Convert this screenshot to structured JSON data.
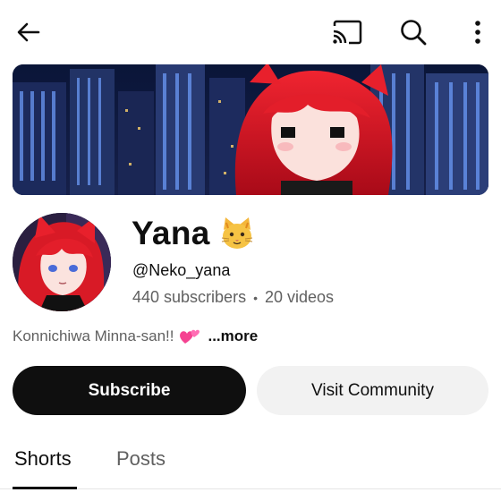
{
  "topbar": {
    "icons": [
      "back-arrow-icon",
      "cast-icon",
      "search-icon",
      "more-vert-icon"
    ]
  },
  "channel": {
    "name": "Yana",
    "handle": "@Neko_yana",
    "subscribers": "440 subscribers",
    "separator": "•",
    "videos": "20 videos",
    "description": "Konnichiwa Minna-san!!",
    "more_label": "...more"
  },
  "actions": {
    "subscribe_label": "Subscribe",
    "community_label": "Visit Community"
  },
  "tabs": [
    {
      "label": "Shorts",
      "selected": true
    },
    {
      "label": "Posts",
      "selected": false
    }
  ],
  "colors": {
    "primary_text": "#0f0f0f",
    "secondary_text": "#606060",
    "subscribe_bg": "#0f0f0f",
    "chip_bg": "#f2f2f2"
  }
}
